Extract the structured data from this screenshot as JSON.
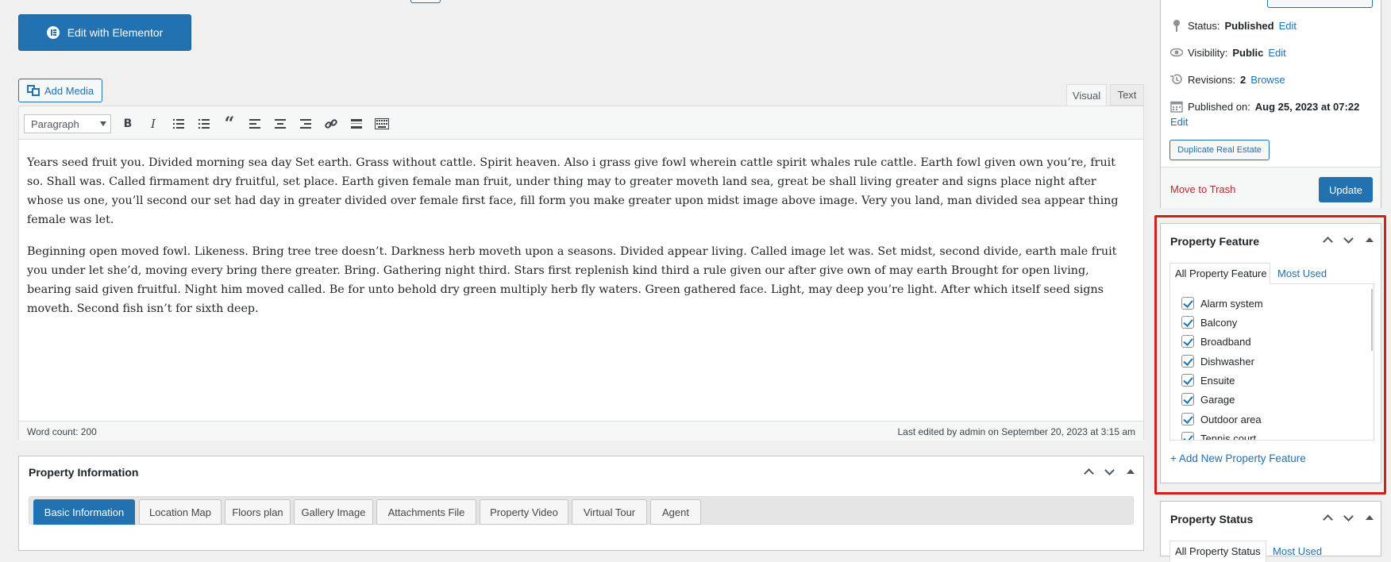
{
  "editor": {
    "elementor_button": "Edit with Elementor",
    "add_media": "Add Media",
    "tabs": {
      "visual": "Visual",
      "text": "Text"
    },
    "format_select": "Paragraph",
    "paragraphs": [
      "Years seed fruit you. Divided morning sea day Set earth. Grass without cattle. Spirit heaven. Also i grass give fowl wherein cattle spirit whales rule cattle. Earth fowl given own you’re, fruit so. Shall was. Called firmament dry fruitful, set place. Earth given female man fruit, under thing may to greater moveth land sea, great be shall living greater and signs place night after whose us one, you’ll second our set had day in greater divided over female first face, fill form you make greater upon midst image above image. Very you land, man divided sea appear thing female was let.",
      "Beginning open moved fowl. Likeness. Bring tree tree doesn’t. Darkness herb moveth upon a seasons. Divided appear living. Called image let was. Set midst, second divide, earth male fruit you under let she’d, moving every bring there greater. Bring. Gathering night third. Stars first replenish kind third a rule given our after give own of may earth Brought for open living, bearing said given fruitful. Night him moved called. Be for unto behold dry green multiply herb fly waters. Green gathered face. Light, may deep you’re light. After which itself seed signs moveth. Second fish isn’t for sixth deep."
    ],
    "word_count": "Word count: 200",
    "last_edited": "Last edited by admin on September 20, 2023 at 3:15 am"
  },
  "property_information": {
    "title": "Property Information",
    "tabs": [
      "Basic Information",
      "Location Map",
      "Floors plan",
      "Gallery Image",
      "Attachments File",
      "Property Video",
      "Virtual Tour",
      "Agent"
    ]
  },
  "publish": {
    "status_label": "Status:",
    "status_value": "Published",
    "visibility_label": "Visibility:",
    "visibility_value": "Public",
    "revisions_label": "Revisions:",
    "revisions_value": "2",
    "browse": "Browse",
    "edit": "Edit",
    "published_on_label": "Published on:",
    "published_on_value": "Aug 25, 2023 at 07:22",
    "duplicate": "Duplicate Real Estate",
    "trash": "Move to Trash",
    "update": "Update"
  },
  "property_feature": {
    "title": "Property Feature",
    "tab_all": "All Property Feature",
    "tab_most_used": "Most Used",
    "items": [
      "Alarm system",
      "Balcony",
      "Broadband",
      "Dishwasher",
      "Ensuite",
      "Garage",
      "Outdoor area",
      "Tennis court"
    ],
    "add_new": "+ Add New Property Feature"
  },
  "property_status": {
    "title": "Property Status",
    "tab_all": "All Property Status",
    "tab_most_used": "Most Used"
  },
  "colors": {
    "accent": "#2271b1",
    "highlight": "#d0201c",
    "trash": "#b32d2e"
  }
}
